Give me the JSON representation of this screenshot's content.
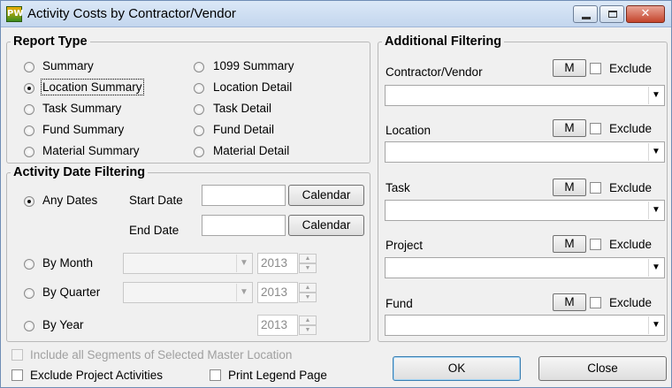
{
  "window": {
    "title": "Activity Costs by Contractor/Vendor",
    "app_icon_text": "PW",
    "min_icon": "minimize-icon",
    "max_icon": "maximize-icon",
    "close_icon": "close-icon"
  },
  "report_type": {
    "legend": "Report Type",
    "options": [
      {
        "label": "Summary",
        "checked": false
      },
      {
        "label": "Location Summary",
        "checked": true
      },
      {
        "label": "Task Summary",
        "checked": false
      },
      {
        "label": "Fund Summary",
        "checked": false
      },
      {
        "label": "Material Summary",
        "checked": false
      },
      {
        "label": "1099 Summary",
        "checked": false
      },
      {
        "label": "Location Detail",
        "checked": false
      },
      {
        "label": "Task Detail",
        "checked": false
      },
      {
        "label": "Fund Detail",
        "checked": false
      },
      {
        "label": "Material Detail",
        "checked": false
      }
    ]
  },
  "date_filtering": {
    "legend": "Activity Date Filtering",
    "any_dates": "Any Dates",
    "start_date_label": "Start Date",
    "end_date_label": "End Date",
    "start_date_value": "",
    "end_date_value": "",
    "calendar_label": "Calendar",
    "by_month": "By Month",
    "by_quarter": "By Quarter",
    "by_year": "By Year",
    "month_year": "2013",
    "quarter_year": "2013",
    "year_year": "2013",
    "selected": "any_dates"
  },
  "options": {
    "include_segments": "Include all Segments of Selected Master Location",
    "exclude_project": "Exclude Project Activities",
    "print_legend": "Print Legend Page"
  },
  "additional_filtering": {
    "legend": "Additional Filtering",
    "m_label": "M",
    "exclude_label": "Exclude",
    "filters": [
      {
        "label": "Contractor/Vendor",
        "value": ""
      },
      {
        "label": "Location",
        "value": ""
      },
      {
        "label": "Task",
        "value": ""
      },
      {
        "label": "Project",
        "value": ""
      },
      {
        "label": "Fund",
        "value": ""
      }
    ]
  },
  "buttons": {
    "ok": "OK",
    "close": "Close"
  }
}
